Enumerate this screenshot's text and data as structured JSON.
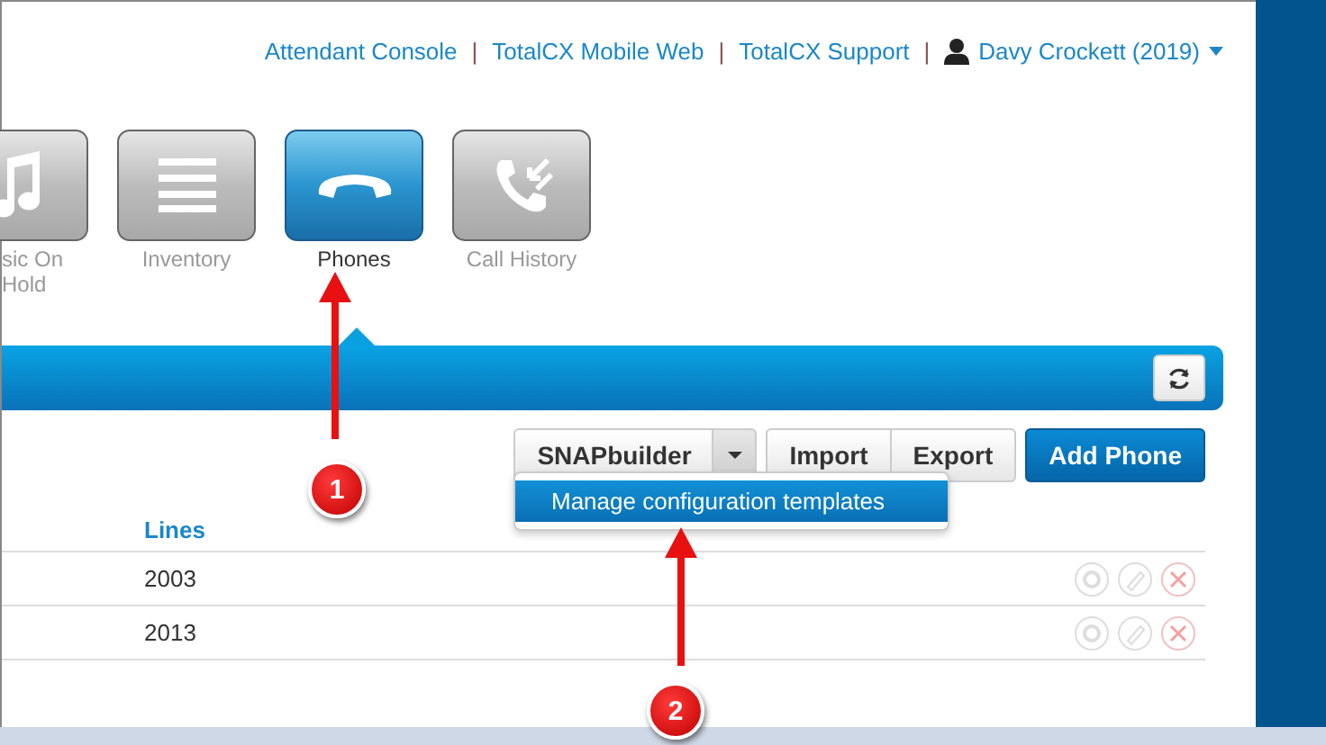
{
  "header_links": [
    {
      "label": "Attendant Console",
      "separator": "|"
    },
    {
      "label": "TotalCX Mobile Web",
      "separator": "|"
    },
    {
      "label": "TotalCX Support",
      "separator": "|"
    }
  ],
  "user_menu": {
    "label": "Davy Crockett (2019)"
  },
  "tiles": [
    {
      "kind": "music",
      "label": "sic On Hold",
      "selected": false
    },
    {
      "kind": "inventory",
      "label": "Inventory",
      "selected": false
    },
    {
      "kind": "phones",
      "label": "Phones",
      "selected": true
    },
    {
      "kind": "history",
      "label": "Call History",
      "selected": false
    }
  ],
  "toolbar": {
    "split_button": "SNAPbuilder",
    "buttons": [
      "Import",
      "Export"
    ],
    "primary_button": "Add Phone"
  },
  "dropdown": {
    "items": [
      {
        "label": "Manage configuration templates",
        "selected": true
      }
    ]
  },
  "table": {
    "columns": [
      "Lines"
    ],
    "rows": [
      {
        "lines": "2003"
      },
      {
        "lines": "2013"
      }
    ]
  },
  "annotations": [
    {
      "number": "1"
    },
    {
      "number": "2"
    }
  ]
}
